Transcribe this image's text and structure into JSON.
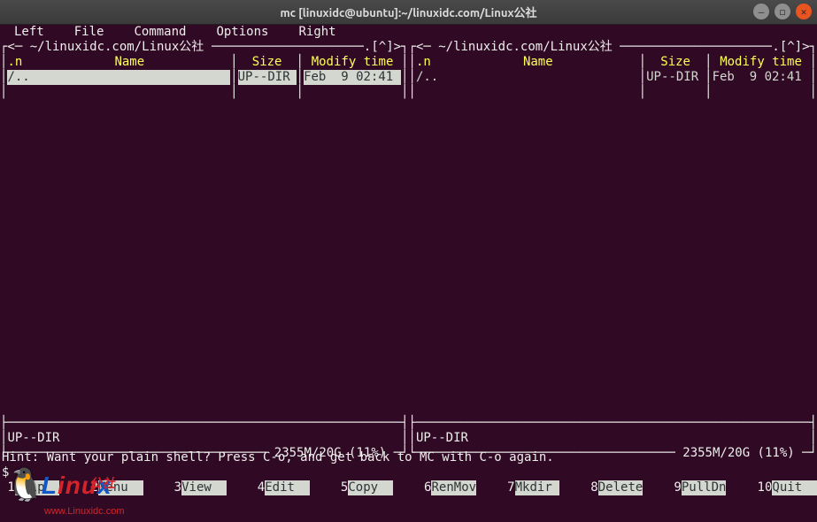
{
  "window": {
    "title": "mc [linuxidc@ubuntu]:~/linuxidc.com/Linux公社"
  },
  "menubar": {
    "left": "Left",
    "file": "File",
    "command": "Command",
    "options": "Options",
    "right": "Right"
  },
  "panel_left": {
    "lead": "┌<─ ",
    "path": "~/linuxidc.com/Linux公社",
    "tail": ".[^]>┐",
    "col_n": ".n",
    "col_name": "Name",
    "col_size": "Size",
    "col_mod": "Modify time",
    "row_name": "/..",
    "row_size": "UP--DIR",
    "row_mod": "Feb  9 02:41",
    "status": "UP--DIR",
    "disk": " 2355M/20G (11%) "
  },
  "panel_right": {
    "lead": "┌<─ ",
    "path": "~/linuxidc.com/Linux公社",
    "tail": ".[^]>┐",
    "col_n": ".n",
    "col_name": "Name",
    "col_size": "Size",
    "col_mod": "Modify time",
    "row_name": "/..",
    "row_size": "UP--DIR",
    "row_mod": "Feb  9 02:41",
    "status": "UP--DIR",
    "disk": " 2355M/20G (11%) "
  },
  "hint": "Hint: Want your plain shell? Press C-o, and get back to MC with C-o again.",
  "prompt": "$ ",
  "fkeys": {
    "k1": {
      "n": " 1",
      "l": "Help  "
    },
    "k2": {
      "n": " 2",
      "l": "Menu  "
    },
    "k3": {
      "n": " 3",
      "l": "View  "
    },
    "k4": {
      "n": " 4",
      "l": "Edit  "
    },
    "k5": {
      "n": " 5",
      "l": "Copy  "
    },
    "k6": {
      "n": " 6",
      "l": "RenMov"
    },
    "k7": {
      "n": " 7",
      "l": "Mkdir "
    },
    "k8": {
      "n": " 8",
      "l": "Delete"
    },
    "k9": {
      "n": " 9",
      "l": "PullDn"
    },
    "k10": {
      "n": " 10",
      "l": "Quit  "
    }
  },
  "dashes": "──────────────────────────────────────────────────────────────────────────────────────────────",
  "watermark": {
    "text_prefix": "L",
    "text_mid": "inu",
    "text_suffix": "x",
    "cn": "公社",
    "url": "www.Linuxidc.com"
  }
}
